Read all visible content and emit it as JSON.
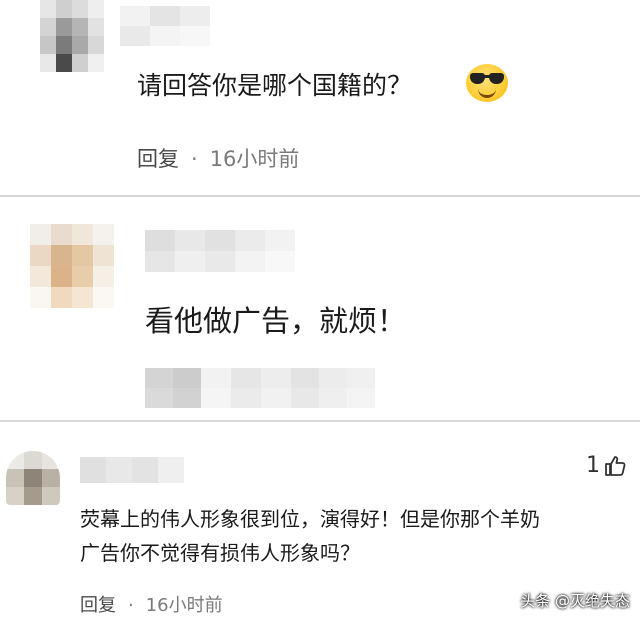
{
  "comments": [
    {
      "text": "请回答你是哪个国籍的？",
      "emoji": "sunglasses-emoji",
      "reply_label": "回复",
      "separator": "·",
      "time": "16小时前"
    },
    {
      "text": "看他做广告，就烦！"
    },
    {
      "like_count": "1",
      "text_line1": "荧幕上的伟人形象很到位，演得好！但是你那个羊奶",
      "text_line2": "广告你不觉得有损伟人形象吗？",
      "reply_label": "回复",
      "separator": "·",
      "time": "16小时前"
    }
  ],
  "watermark": "头条 @灭绝失态",
  "colors": {
    "text": "#1a1a1a",
    "meta": "#7a7a7a",
    "divider": "#d9d9d9"
  }
}
